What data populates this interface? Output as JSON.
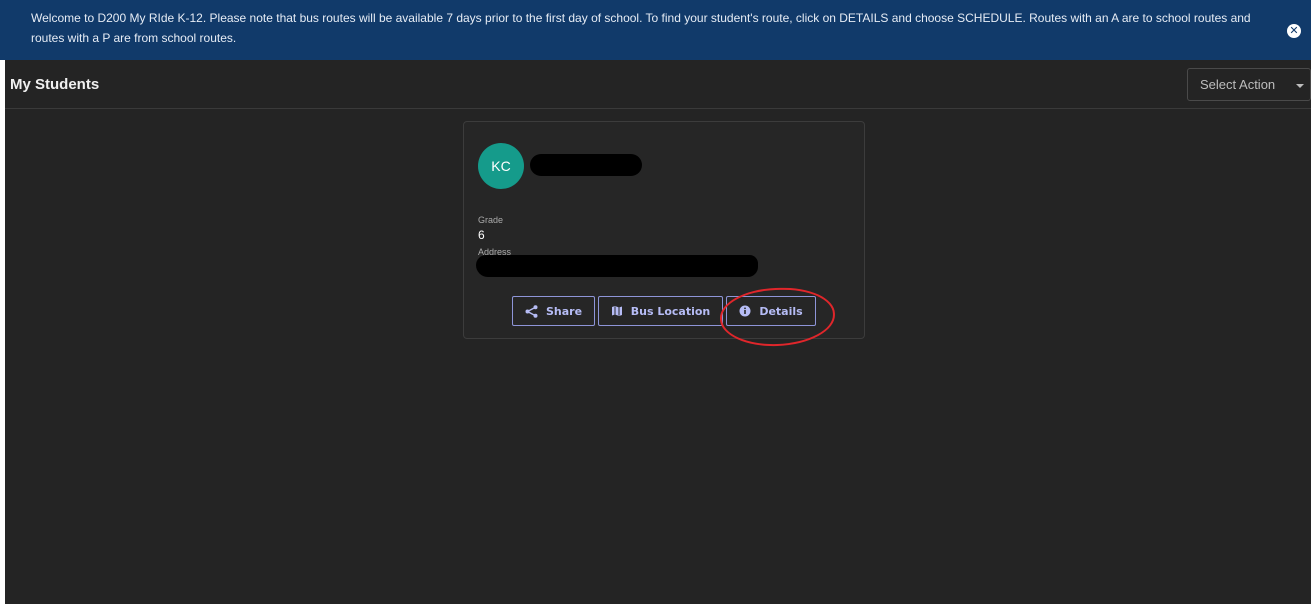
{
  "banner": {
    "message": "Welcome to D200 My RIde K-12. Please note that bus routes will be available 7 days prior to the first day of school. To find your student's route, click on DETAILS and choose SCHEDULE. Routes with an A are to school routes and routes with a P are from school routes.",
    "close_icon": "close-circle-icon",
    "close_glyph": "✕",
    "background": "#113a6a"
  },
  "header": {
    "title": "My Students",
    "select_action": {
      "label": "Select Action",
      "icon": "caret-down-icon"
    }
  },
  "student_card": {
    "avatar_initials": "KC",
    "avatar_color": "#159b8b",
    "grade_label": "Grade",
    "grade_value": "6",
    "address_label": "Address",
    "buttons": {
      "share": {
        "label": "Share",
        "icon": "share-icon"
      },
      "bus_location": {
        "label": "Bus Location",
        "icon": "map-icon"
      },
      "details": {
        "label": "Details",
        "icon": "info-icon"
      }
    }
  },
  "colors": {
    "background": "#242424",
    "accent_button": "#8e95d8",
    "annotation_ring": "#e0262b"
  }
}
